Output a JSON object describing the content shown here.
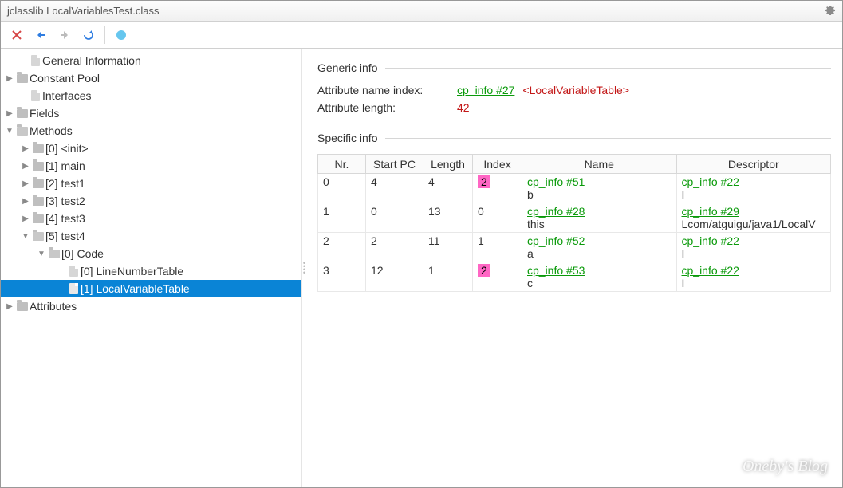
{
  "window": {
    "title": "jclasslib LocalVariablesTest.class"
  },
  "tree": {
    "general_info": "General Information",
    "constant_pool": "Constant Pool",
    "interfaces": "Interfaces",
    "fields": "Fields",
    "methods": "Methods",
    "m0": "[0] <init>",
    "m1": "[1] main",
    "m2": "[2] test1",
    "m3": "[3] test2",
    "m4": "[4] test3",
    "m5": "[5] test4",
    "code": "[0] Code",
    "lnt": "[0] LineNumberTable",
    "lvt": "[1] LocalVariableTable",
    "attributes": "Attributes"
  },
  "generic": {
    "section": "Generic info",
    "attr_name_label": "Attribute name index:",
    "attr_name_link": "cp_info #27",
    "attr_name_tag": "<LocalVariableTable>",
    "attr_len_label": "Attribute length:",
    "attr_len_value": "42"
  },
  "specific": {
    "section": "Specific info",
    "cols": {
      "nr": "Nr.",
      "start": "Start PC",
      "len": "Length",
      "idx": "Index",
      "name": "Name",
      "desc": "Descriptor"
    },
    "rows": [
      {
        "nr": "0",
        "start": "4",
        "len": "4",
        "idx": "2",
        "idx_hl": true,
        "name_link": "cp_info #51",
        "name_sub": "b",
        "desc_link": "cp_info #22",
        "desc_sub": "I"
      },
      {
        "nr": "1",
        "start": "0",
        "len": "13",
        "idx": "0",
        "idx_hl": false,
        "name_link": "cp_info #28",
        "name_sub": "this",
        "desc_link": "cp_info #29",
        "desc_sub": "Lcom/atguigu/java1/LocalV"
      },
      {
        "nr": "2",
        "start": "2",
        "len": "11",
        "idx": "1",
        "idx_hl": false,
        "name_link": "cp_info #52",
        "name_sub": "a",
        "desc_link": "cp_info #22",
        "desc_sub": "I"
      },
      {
        "nr": "3",
        "start": "12",
        "len": "1",
        "idx": "2",
        "idx_hl": true,
        "name_link": "cp_info #53",
        "name_sub": "c",
        "desc_link": "cp_info #22",
        "desc_sub": "I"
      }
    ]
  },
  "watermark": "Oneby's Blog"
}
